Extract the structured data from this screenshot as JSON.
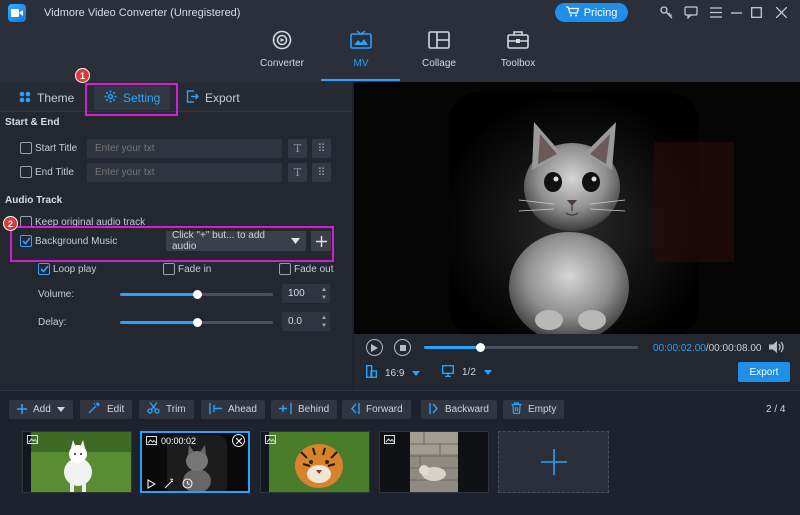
{
  "app": {
    "title": "Vidmore Video Converter (Unregistered)",
    "pricing_label": "Pricing"
  },
  "nav": {
    "items": [
      {
        "label": "Converter"
      },
      {
        "label": "MV"
      },
      {
        "label": "Collage"
      },
      {
        "label": "Toolbox"
      }
    ],
    "active": "MV"
  },
  "tabs": {
    "theme": "Theme",
    "setting": "Setting",
    "export": "Export",
    "active": "Setting"
  },
  "annotations": {
    "badge1": "1",
    "badge2": "2",
    "highlight_color": "#d21fd0"
  },
  "start_end": {
    "heading": "Start & End",
    "start_title_label": "Start Title",
    "start_title_placeholder": "Enter your txt",
    "end_title_label": "End Title",
    "end_title_placeholder": "Enter your txt",
    "start_title_checked": false,
    "end_title_checked": false
  },
  "audio": {
    "heading": "Audio Track",
    "keep_original_label": "Keep original audio track",
    "keep_original_checked": false,
    "bg_music_label": "Background Music",
    "bg_music_checked": true,
    "bg_music_select": "Click \"+\" but... to add audio",
    "loop_play_label": "Loop play",
    "loop_play_checked": true,
    "fade_in_label": "Fade in",
    "fade_in_checked": false,
    "fade_out_label": "Fade out",
    "fade_out_checked": false,
    "volume_label": "Volume:",
    "volume_value": "100",
    "volume_level_fraction": 0.5,
    "delay_label": "Delay:",
    "delay_value": "0.0",
    "delay_level_fraction": 0.5
  },
  "player": {
    "current_time": "00:00:02.00",
    "total_time": "00:00:08.00",
    "time_sep": "/",
    "progress_fraction": 0.25,
    "aspect_ratio": "16:9",
    "zoom": "1/2",
    "export_label": "Export"
  },
  "toolbar": {
    "add": "Add",
    "edit": "Edit",
    "trim": "Trim",
    "ahead": "Ahead",
    "behind": "Behind",
    "forward": "Forward",
    "backward": "Backward",
    "empty": "Empty",
    "page_count": "2 / 4"
  },
  "clips": [
    {
      "subject": "white dog on grass",
      "selected": false
    },
    {
      "subject": "cat in dark",
      "selected": true,
      "time": "00:00:02"
    },
    {
      "subject": "tiger in grass",
      "selected": false
    },
    {
      "subject": "cat on stone wall",
      "selected": false
    }
  ],
  "colors": {
    "accent": "#27a3ff",
    "bg": "#1e222c",
    "panel": "#23272f"
  }
}
